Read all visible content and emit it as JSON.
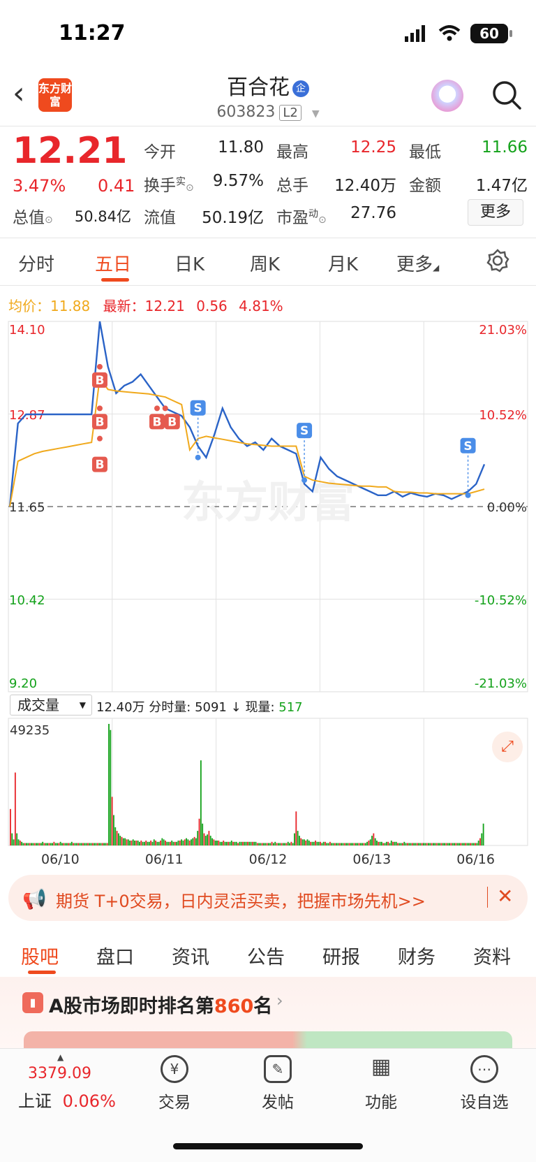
{
  "status": {
    "time": "11:27",
    "battery": "60"
  },
  "header": {
    "back": "‹",
    "logo_text": "东方财富",
    "name": "百合花",
    "tag": "企",
    "code": "603823",
    "level": "L2"
  },
  "quote": {
    "price": "12.21",
    "pct": "3.47%",
    "change": "0.41",
    "open_label": "今开",
    "open": "11.80",
    "high_label": "最高",
    "high": "12.25",
    "low_label": "最低",
    "low": "11.66",
    "turnover_label": "换手",
    "turnover_sup": "实",
    "turnover": "9.57%",
    "volume_label": "总手",
    "volume": "12.40万",
    "amount_label": "金额",
    "amount": "1.47亿",
    "mktcap_label": "总值",
    "mktcap": "50.84亿",
    "float_label": "流值",
    "float": "50.19亿",
    "pe_label": "市盈",
    "pe_sup": "动",
    "pe": "27.76",
    "more": "更多"
  },
  "period_tabs": [
    "分时",
    "五日",
    "日K",
    "周K",
    "月K",
    "更多"
  ],
  "period_active": 1,
  "legend": {
    "avg_label": "均价：",
    "avg": "11.88",
    "last_label": "最新：",
    "last": "12.21",
    "last_chg": "0.56",
    "last_pct": "4.81%"
  },
  "chart_data": {
    "type": "line",
    "x": [
      "06/10",
      "06/11",
      "06/12",
      "06/13",
      "06/16"
    ],
    "y_ticks_left": [
      "14.10",
      "12.87",
      "11.65",
      "10.42",
      "9.20"
    ],
    "y_ticks_right": [
      "21.03%",
      "10.52%",
      "0.00%",
      "-10.52%",
      "-21.03%"
    ],
    "ylim": [
      9.2,
      14.1
    ],
    "baseline": 11.65,
    "series": [
      {
        "name": "",
        "color": "#2a63c7",
        "values": [
          11.65,
          12.75,
          12.87,
          12.87,
          12.87,
          12.87,
          12.87,
          12.87,
          12.87,
          12.87,
          12.87,
          14.1,
          13.5,
          13.15,
          13.25,
          13.3,
          13.4,
          13.25,
          13.1,
          12.95,
          12.9,
          12.85,
          12.7,
          12.45,
          12.3,
          12.6,
          12.95,
          12.7,
          12.55,
          12.45,
          12.5,
          12.4,
          12.55,
          12.45,
          12.4,
          12.35,
          11.95,
          11.85,
          12.3,
          12.15,
          12.05,
          12.0,
          11.95,
          11.9,
          11.85,
          11.8,
          11.8,
          11.85,
          11.78,
          11.83,
          11.8,
          11.78,
          11.82,
          11.8,
          11.75,
          11.8,
          11.85,
          11.95,
          12.21
        ]
      },
      {
        "name": "",
        "color": "#f0a91c",
        "values": [
          11.65,
          12.25,
          12.3,
          12.35,
          12.38,
          12.4,
          12.42,
          12.44,
          12.46,
          12.48,
          12.5,
          13.35,
          13.2,
          13.18,
          13.17,
          13.16,
          13.15,
          13.14,
          13.12,
          13.1,
          13.05,
          13.0,
          12.4,
          12.55,
          12.58,
          12.56,
          12.54,
          12.52,
          12.5,
          12.48,
          12.47,
          12.46,
          12.45,
          12.45,
          12.45,
          12.45,
          12.05,
          12.0,
          11.98,
          11.96,
          11.95,
          11.94,
          11.93,
          11.92,
          11.92,
          11.91,
          11.91,
          11.85,
          11.84,
          11.84,
          11.83,
          11.83,
          11.82,
          11.82,
          11.82,
          11.82,
          11.82,
          11.85,
          11.88
        ]
      }
    ],
    "markers": [
      {
        "label": "B",
        "color": "#e55a4f",
        "x_idx": 11,
        "price": 13.5
      },
      {
        "label": "B",
        "color": "#e55a4f",
        "x_idx": 11,
        "price": 12.95
      },
      {
        "label": "B",
        "color": "#e55a4f",
        "x_idx": 11,
        "price": 12.55
      },
      {
        "label": "B",
        "color": "#e55a4f",
        "x_idx": 18,
        "price": 12.95
      },
      {
        "label": "B",
        "color": "#e55a4f",
        "x_idx": 19,
        "price": 12.95
      },
      {
        "label": "S",
        "color": "#4a8de8",
        "x_idx": 23,
        "price": 12.3
      },
      {
        "label": "S",
        "color": "#4a8de8",
        "x_idx": 36,
        "price": 12.0
      },
      {
        "label": "S",
        "color": "#4a8de8",
        "x_idx": 56,
        "price": 11.8
      }
    ]
  },
  "volume": {
    "select": "成交量",
    "total": "12.40万",
    "seg_label": "分时量:",
    "seg_value": "5091",
    "seg_arrow": "↓",
    "now_label": "现量:",
    "now_value": "517",
    "max_label": "49235",
    "bars": [
      0.3,
      0.1,
      0.05,
      0.6,
      0.1,
      0.05,
      0.04,
      0.03,
      0.02,
      0.02,
      0.02,
      0.02,
      0.02,
      0.02,
      0.02,
      0.02,
      0.02,
      0.02,
      0.02,
      0.02,
      0.03,
      0.02,
      0.02,
      0.02,
      0.02,
      0.02,
      0.02,
      0.03,
      0.02,
      0.02,
      0.02,
      0.03,
      0.02,
      0.02,
      0.02,
      0.02,
      0.02,
      0.02,
      0.03,
      0.02,
      0.02,
      0.02,
      0.02,
      0.02,
      0.02,
      0.02,
      0.02,
      0.02,
      0.02,
      0.02,
      0.02,
      0.02,
      0.02,
      0.02,
      0.02,
      0.02,
      0.02,
      0.02,
      0.02,
      0.02,
      0.02,
      1.0,
      0.95,
      0.4,
      0.25,
      0.15,
      0.12,
      0.1,
      0.08,
      0.07,
      0.06,
      0.06,
      0.05,
      0.05,
      0.04,
      0.04,
      0.05,
      0.04,
      0.04,
      0.04,
      0.03,
      0.04,
      0.03,
      0.03,
      0.04,
      0.03,
      0.03,
      0.04,
      0.03,
      0.05,
      0.04,
      0.03,
      0.03,
      0.04,
      0.06,
      0.05,
      0.04,
      0.03,
      0.03,
      0.03,
      0.04,
      0.03,
      0.03,
      0.03,
      0.04,
      0.04,
      0.05,
      0.04,
      0.05,
      0.06,
      0.05,
      0.04,
      0.05,
      0.06,
      0.07,
      0.06,
      0.12,
      0.22,
      0.7,
      0.18,
      0.1,
      0.08,
      0.09,
      0.12,
      0.08,
      0.06,
      0.05,
      0.04,
      0.04,
      0.04,
      0.03,
      0.03,
      0.04,
      0.03,
      0.03,
      0.03,
      0.03,
      0.04,
      0.03,
      0.03,
      0.03,
      0.02,
      0.03,
      0.03,
      0.03,
      0.03,
      0.03,
      0.03,
      0.03,
      0.03,
      0.03,
      0.03,
      0.03,
      0.02,
      0.02,
      0.02,
      0.02,
      0.02,
      0.02,
      0.02,
      0.02,
      0.02,
      0.03,
      0.02,
      0.03,
      0.02,
      0.02,
      0.02,
      0.02,
      0.02,
      0.02,
      0.02,
      0.03,
      0.02,
      0.03,
      0.02,
      0.1,
      0.28,
      0.12,
      0.08,
      0.06,
      0.05,
      0.05,
      0.04,
      0.05,
      0.04,
      0.03,
      0.03,
      0.03,
      0.04,
      0.03,
      0.03,
      0.03,
      0.02,
      0.03,
      0.03,
      0.02,
      0.02,
      0.03,
      0.02,
      0.02,
      0.02,
      0.02,
      0.02,
      0.02,
      0.02,
      0.02,
      0.02,
      0.02,
      0.02,
      0.02,
      0.02,
      0.02,
      0.02,
      0.02,
      0.02,
      0.02,
      0.02,
      0.02,
      0.02,
      0.02,
      0.03,
      0.04,
      0.05,
      0.08,
      0.1,
      0.06,
      0.04,
      0.03,
      0.03,
      0.03,
      0.02,
      0.02,
      0.03,
      0.03,
      0.02,
      0.04,
      0.03,
      0.03,
      0.03,
      0.02,
      0.02,
      0.02,
      0.02,
      0.03,
      0.02,
      0.02,
      0.02,
      0.02,
      0.02,
      0.02,
      0.02,
      0.02,
      0.02,
      0.02,
      0.02,
      0.02,
      0.02,
      0.02,
      0.02,
      0.02,
      0.02,
      0.02,
      0.02,
      0.02,
      0.02,
      0.02,
      0.02,
      0.02,
      0.02,
      0.02,
      0.02,
      0.02,
      0.02,
      0.02,
      0.02,
      0.02,
      0.02,
      0.02,
      0.02,
      0.02,
      0.02,
      0.02,
      0.02,
      0.02,
      0.02,
      0.02,
      0.02,
      0.02,
      0.02,
      0.04,
      0.06,
      0.1,
      0.18
    ]
  },
  "banner": {
    "text": "期货 T+0交易，日内灵活买卖，把握市场先机>>",
    "close": "✕"
  },
  "content_tabs": [
    "股吧",
    "盘口",
    "资讯",
    "公告",
    "研报",
    "财务",
    "资料"
  ],
  "content_active": 0,
  "rank": {
    "prefix": "A股市场即时排名第",
    "num": "860",
    "suffix": "名"
  },
  "bottom": {
    "index_value": "3379.09",
    "index_name": "上证",
    "index_pct": "0.06%",
    "nav": [
      {
        "icon": "trade-icon",
        "glyph": "¥",
        "label": "交易"
      },
      {
        "icon": "post-icon",
        "glyph": "✎",
        "label": "发帖"
      },
      {
        "icon": "function-icon",
        "glyph": "▦",
        "label": "功能"
      },
      {
        "icon": "watchlist-icon",
        "glyph": "⋯",
        "label": "设自选"
      }
    ]
  },
  "watermark": "东方财富"
}
